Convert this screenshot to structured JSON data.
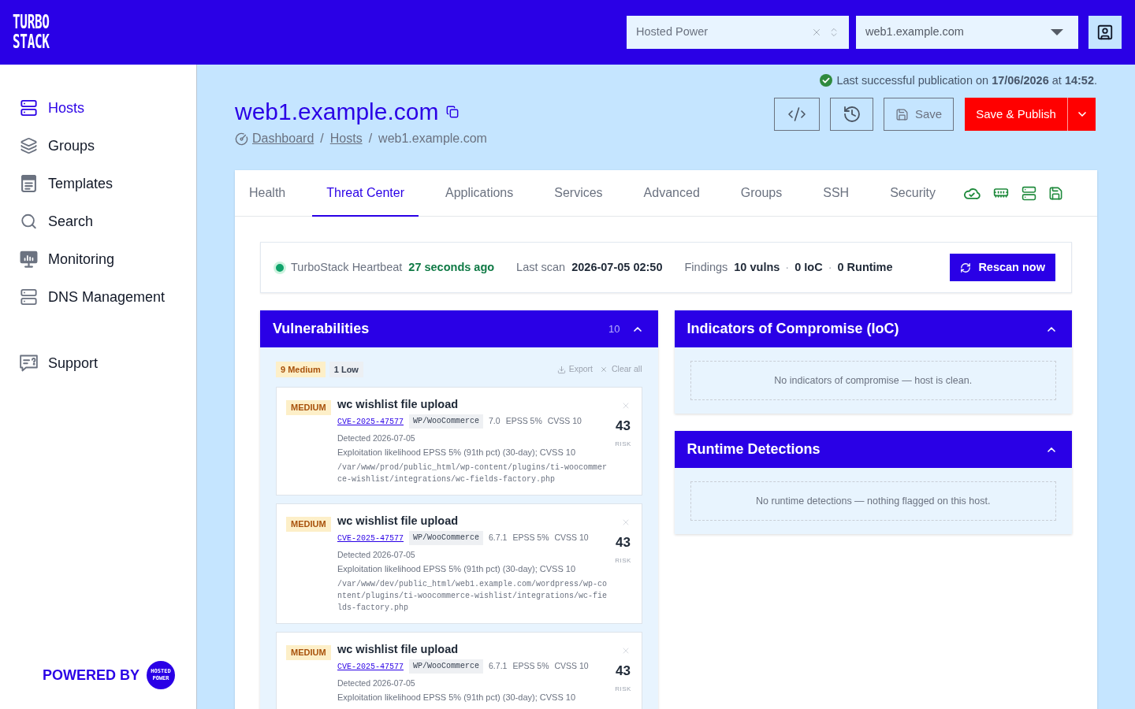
{
  "top_bar": {
    "logo": {
      "line_1": "TURBO",
      "line_2": "STACK"
    },
    "organization_select": {
      "value": "Hosted Power"
    },
    "host_select": {
      "value": "web1.example.com"
    }
  },
  "sidebar": {
    "items": [
      {
        "label": "Hosts",
        "selected": true
      },
      {
        "label": "Groups",
        "selected": false
      },
      {
        "label": "Templates",
        "selected": false
      },
      {
        "label": "Search",
        "selected": false
      },
      {
        "label": "Monitoring",
        "selected": false
      },
      {
        "label": "DNS Management",
        "selected": false
      }
    ],
    "secondary_items": [
      {
        "label": "Support",
        "selected": false
      }
    ],
    "powered_by": {
      "label": "POWERED BY",
      "logo_line_1": "HOSTED",
      "logo_line_2": "POWER"
    }
  },
  "publication": {
    "text": "Last successful publication on **17/06/2026** at **14:52**."
  },
  "header": {
    "title": "web1.example.com",
    "breadcrumb": [
      {
        "kind": "link",
        "text": "Dashboard"
      },
      {
        "kind": "separator",
        "text": "/"
      },
      {
        "kind": "link",
        "text": "Hosts"
      },
      {
        "kind": "separator",
        "text": "/"
      },
      {
        "kind": "current",
        "text": "web1.example.com"
      }
    ]
  },
  "actions": {
    "save": "Save",
    "publish": "Save & Publish"
  },
  "tabs": [
    {
      "label": "Health",
      "selected": false
    },
    {
      "label": "Threat Center",
      "selected": true
    },
    {
      "label": "Applications",
      "selected": false
    },
    {
      "label": "Services",
      "selected": false
    },
    {
      "label": "Advanced",
      "selected": false
    },
    {
      "label": "Groups",
      "selected": false
    },
    {
      "label": "SSH",
      "selected": false
    },
    {
      "label": "Security",
      "selected": false
    }
  ],
  "heartbeat": {
    "online": true,
    "label": "TurboStack Heartbeat",
    "age": "27 seconds ago",
    "last_scan_label": "Last scan",
    "last_scan": "2026-07-05 02:50",
    "findings_label": "Findings",
    "findings": [
      {
        "kind": "value",
        "text": "10 vulns"
      },
      {
        "kind": "separator",
        "text": "·"
      },
      {
        "kind": "value",
        "text": "0 IoC"
      },
      {
        "kind": "separator",
        "text": "·"
      },
      {
        "kind": "value",
        "text": "0 Runtime"
      }
    ],
    "rescan_button": "Rescan now"
  },
  "vulnerabilities": {
    "title": "Vulnerabilities",
    "count": "10",
    "expanded": true,
    "filters": [
      {
        "kind": "medium",
        "label": "9 Medium"
      },
      {
        "kind": "low",
        "label": "1 Low"
      }
    ],
    "export": "Export",
    "clear_all": "Clear all",
    "items": [
      {
        "kind": "medium",
        "badge": "MEDIUM",
        "title": "wc wishlist file upload",
        "cve": "CVE-2025-47577",
        "package": "WP/WooCommerce",
        "version": "7.0",
        "epss": "EPSS 5%",
        "cvss": "CVSS 10",
        "detected": "Detected 2026-07-05",
        "description": "Exploitation likelihood EPSS 5% (91th pct) (30-day); CVSS 10",
        "path": "/var/www/prod/public_html/wp-content/plugins/ti-woocommerce-wishlist/integrations/wc-fields-factory.php",
        "risk": "43",
        "risk_label": "RISK"
      },
      {
        "kind": "medium",
        "badge": "MEDIUM",
        "title": "wc wishlist file upload",
        "cve": "CVE-2025-47577",
        "package": "WP/WooCommerce",
        "version": "6.7.1",
        "epss": "EPSS 5%",
        "cvss": "CVSS 10",
        "detected": "Detected 2026-07-05",
        "description": "Exploitation likelihood EPSS 5% (91th pct) (30-day); CVSS 10",
        "path": "/var/www/dev/public_html/web1.example.com/wordpress/wp-content/plugins/ti-woocommerce-wishlist/integrations/wc-fields-factory.php",
        "risk": "43",
        "risk_label": "RISK"
      },
      {
        "kind": "medium",
        "badge": "MEDIUM",
        "title": "wc wishlist file upload",
        "cve": "CVE-2025-47577",
        "package": "WP/WooCommerce",
        "version": "6.7.1",
        "epss": "EPSS 5%",
        "cvss": "CVSS 10",
        "detected": "Detected 2026-07-05",
        "description": "Exploitation likelihood EPSS 5% (91th pct) (30-day); CVSS 10",
        "risk": "43",
        "risk_label": "RISK"
      }
    ]
  },
  "ioc": {
    "title": "Indicators of Compromise (IoC)",
    "expanded": true,
    "empty_message": "No indicators of compromise — host is clean."
  },
  "runtime": {
    "title": "Runtime Detections",
    "expanded": true,
    "empty_message": "No runtime detections — nothing flagged on this host."
  }
}
